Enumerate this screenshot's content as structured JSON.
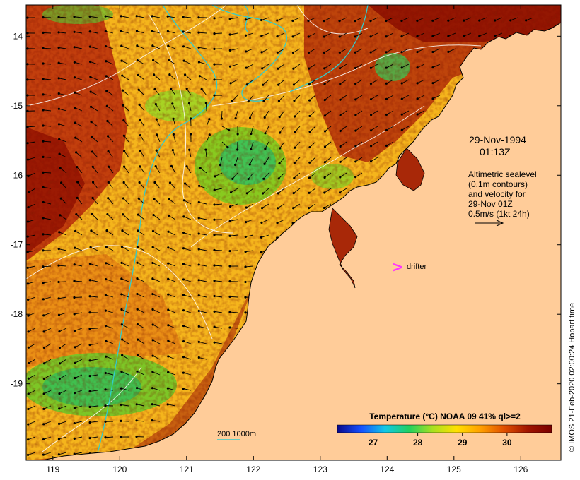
{
  "map": {
    "lon_ticks": [
      "119",
      "120",
      "121",
      "122",
      "123",
      "124",
      "125",
      "126"
    ],
    "lat_ticks": [
      "-14",
      "-15",
      "-16",
      "-17",
      "-18",
      "-19"
    ],
    "lon_range": [
      118.6,
      126.6
    ],
    "lat_range": [
      -20.1,
      -13.55
    ]
  },
  "annotations": {
    "date": "29-Nov-1994",
    "time": "01:13Z",
    "info_lines": [
      "Altimetric sealevel",
      "(0.1m contours)",
      "and velocity for",
      "29-Nov 01Z",
      "0.5m/s (1kt 24h)"
    ],
    "drifter_label": "drifter",
    "drifter_marker": ">"
  },
  "bathymetry_legend": {
    "text": "200  1000m"
  },
  "colorbar": {
    "title": "Temperature (°C) NOAA 09 41% ql>=2",
    "ticks": [
      "27",
      "28",
      "29",
      "30"
    ],
    "tick_values": [
      27,
      28,
      29,
      30
    ],
    "range": [
      26.2,
      31.0
    ],
    "colors": [
      "#0a0a8c",
      "#1450ff",
      "#11c8e6",
      "#20d060",
      "#a8e020",
      "#ffe000",
      "#ffa000",
      "#e05000",
      "#a01400",
      "#7a0000"
    ]
  },
  "credit": "© IMOS 21-Feb-2020 02:00:24 Hobart time",
  "colors": {
    "land": "#ffcc99",
    "contour": "#ffffff",
    "isobath": "#33cccc",
    "coast": "#000000",
    "drifter": "#ff33ff",
    "arrow": "#000000"
  }
}
